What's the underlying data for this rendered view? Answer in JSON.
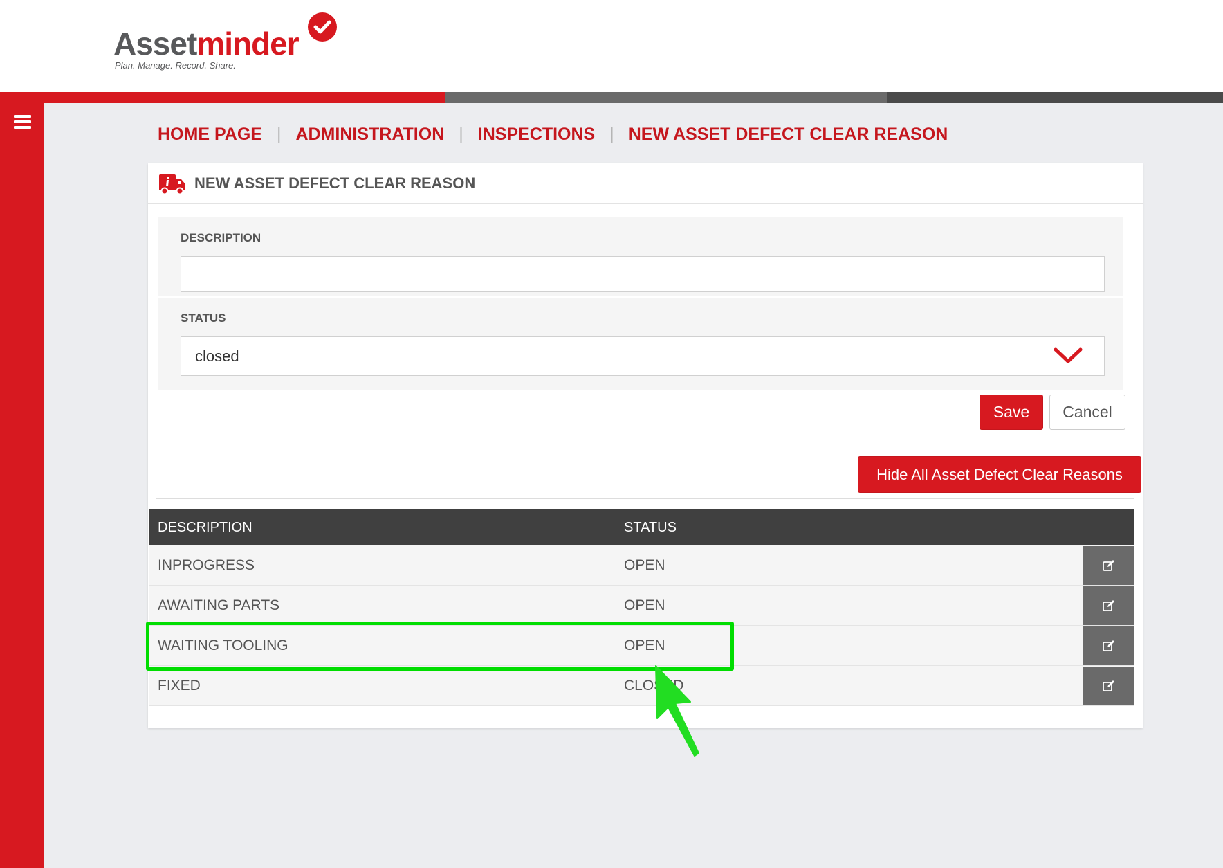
{
  "brand": {
    "name_part1": "Asset",
    "name_part2": "minder",
    "tagline": "Plan. Manage. Record. Share."
  },
  "breadcrumb": [
    {
      "label": "HOME PAGE"
    },
    {
      "label": "ADMINISTRATION"
    },
    {
      "label": "INSPECTIONS"
    },
    {
      "label": "NEW ASSET DEFECT CLEAR REASON"
    }
  ],
  "card": {
    "title": "NEW ASSET DEFECT CLEAR REASON",
    "icon": "truck-info-icon"
  },
  "form": {
    "description_label": "DESCRIPTION",
    "description_value": "",
    "status_label": "STATUS",
    "status_value": "closed"
  },
  "buttons": {
    "save": "Save",
    "cancel": "Cancel",
    "hide_all": "Hide All Asset Defect Clear Reasons"
  },
  "table": {
    "headers": [
      "DESCRIPTION",
      "STATUS"
    ],
    "rows": [
      {
        "description": "INPROGRESS",
        "status": "OPEN"
      },
      {
        "description": "AWAITING PARTS",
        "status": "OPEN"
      },
      {
        "description": "WAITING TOOLING",
        "status": "OPEN"
      },
      {
        "description": "FIXED",
        "status": "CLOSED"
      }
    ]
  },
  "colors": {
    "brand_red": "#d71920",
    "header_dark": "#404040",
    "edit_button": "#6a6a6a",
    "annotation_green": "#00dd00"
  }
}
